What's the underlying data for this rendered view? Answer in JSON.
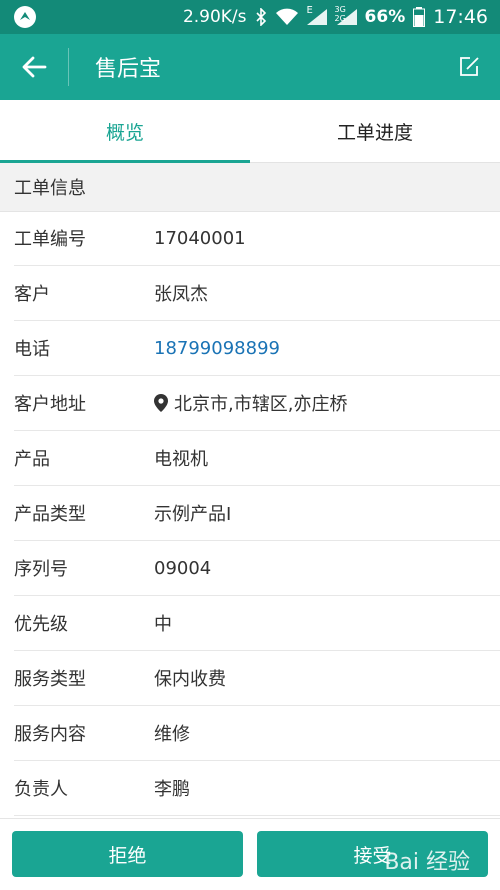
{
  "status": {
    "speed": "2.90K/s",
    "battery": "66%",
    "time": "17:46",
    "net_e": "E",
    "net_3g": "3G",
    "net_2g": "2G"
  },
  "appbar": {
    "title": "售后宝"
  },
  "tabs": [
    {
      "label": "概览",
      "active": true
    },
    {
      "label": "工单进度",
      "active": false
    }
  ],
  "section": {
    "title": "工单信息"
  },
  "fields": [
    {
      "label": "工单编号",
      "value": "17040001"
    },
    {
      "label": "客户",
      "value": "张凤杰"
    },
    {
      "label": "电话",
      "value": "18799098899"
    },
    {
      "label": "客户地址",
      "value": "北京市,市辖区,亦庄桥"
    },
    {
      "label": "产品",
      "value": "电视机"
    },
    {
      "label": "产品类型",
      "value": "示例产品I"
    },
    {
      "label": "序列号",
      "value": "09004"
    },
    {
      "label": "优先级",
      "value": "中"
    },
    {
      "label": "服务类型",
      "value": "保内收费"
    },
    {
      "label": "服务内容",
      "value": "维修"
    },
    {
      "label": "负责人",
      "value": "李鹏"
    }
  ],
  "buttons": {
    "reject": "拒绝",
    "accept": "接受"
  },
  "watermark": {
    "text": "Bai 经验",
    "url": "jingyan.baidu.com"
  },
  "colors": {
    "primary": "#1aa593",
    "status": "#138a78",
    "link": "#1a73b5"
  }
}
